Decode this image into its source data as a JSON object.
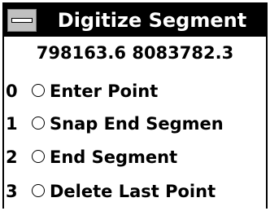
{
  "window": {
    "title": "Digitize Segment",
    "sysmenu_icon": "system-menu-icon"
  },
  "coordinates": {
    "text": "798163.6  8083782.3"
  },
  "options": [
    {
      "key": "0",
      "label": "Enter Point",
      "selected": false
    },
    {
      "key": "1",
      "label": "Snap End Segmen",
      "selected": false
    },
    {
      "key": "2",
      "label": "End Segment",
      "selected": false
    },
    {
      "key": "3",
      "label": "Delete Last Point",
      "selected": false
    }
  ],
  "colors": {
    "titlebar": "#000000",
    "title_text": "#ffffff",
    "background": "#ffffff"
  }
}
